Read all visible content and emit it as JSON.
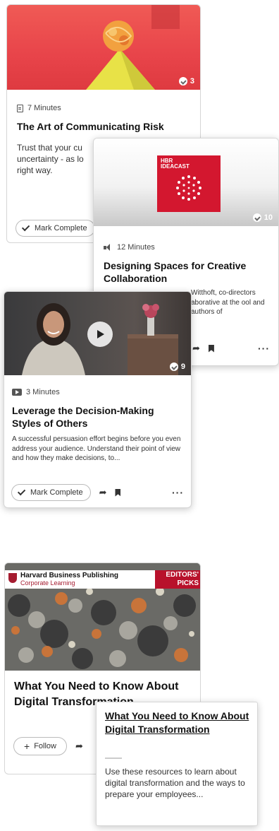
{
  "card1": {
    "count": "3",
    "duration": "7 Minutes",
    "title": "The Art of Communicating Risk",
    "desc": "Trust that your cu uncertainty - as lo right way.",
    "mark": "Mark Complete"
  },
  "card2": {
    "logo_top": "HBR",
    "logo_bottom": "IDEACAST",
    "count": "10",
    "duration": "12 Minutes",
    "title": "Designing Spaces for Creative Collaboration",
    "desc": "Witthoft, co-directors aborative at the ool and authors of"
  },
  "card3": {
    "count": "9",
    "duration": "3 Minutes",
    "title": "Leverage the Decision-Making Styles of Others",
    "desc": "A successful persuasion effort begins before you even address your audience. Understand their point of view and how they make decisions, to...",
    "mark": "Mark Complete"
  },
  "card4": {
    "brand_line1": "Harvard Business Publishing",
    "brand_line2": "Corporate Learning",
    "editors_line1": "EDITORS'",
    "editors_line2": "PICKS",
    "title": "What You Need to Know About Digital Transformation",
    "follow": "Follow"
  },
  "tooltip": {
    "title": "What You Need to Know About Digital Transformation",
    "desc": "Use these resources to learn about digital transformation and the ways to prepare your employees..."
  },
  "icons": {
    "clock": "doc-icon",
    "audio": "audio-icon",
    "video": "video-icon",
    "share": "share-icon",
    "bookmark": "bookmark-icon",
    "more": "more-icon"
  },
  "colors": {
    "hero_red": "#e8444a",
    "ideacast_red": "#d3172f",
    "editors_red": "#b8112b",
    "accent_text": "#111111"
  }
}
